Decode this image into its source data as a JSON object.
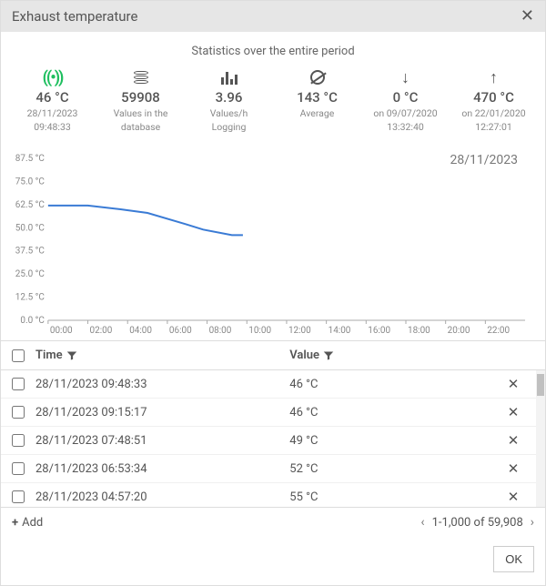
{
  "title": "Exhaust temperature",
  "subtitle": "Statistics over the entire period",
  "stats": {
    "live": {
      "value": "46 °C",
      "sub1": "28/11/2023",
      "sub2": "09:48:33"
    },
    "db": {
      "value": "59908",
      "sub1": "Values in the",
      "sub2": "database"
    },
    "rate": {
      "value": "3.96",
      "sub1": "Values/h",
      "sub2": "Logging"
    },
    "avg": {
      "value": "143 °C",
      "sub1": "Average",
      "sub2": ""
    },
    "min": {
      "value": "0 °C",
      "sub1": "on 09/07/2020",
      "sub2": "13:32:40"
    },
    "max": {
      "value": "470 °C",
      "sub1": "on 22/01/2020",
      "sub2": "12:27:01"
    }
  },
  "chart_data": {
    "type": "line",
    "title": "",
    "date_label": "28/11/2023",
    "xlabel": "",
    "ylabel": "",
    "ylim": [
      0,
      87.5
    ],
    "y_ticks": [
      "87.5 °C",
      "75.0 °C",
      "62.5 °C",
      "50.0 °C",
      "37.5 °C",
      "25.0 °C",
      "12.5 °C",
      "0.0 °C"
    ],
    "x_ticks": [
      "00:00",
      "02:00",
      "04:00",
      "06:00",
      "08:00",
      "10:00",
      "12:00",
      "14:00",
      "16:00",
      "18:00",
      "20:00",
      "22:00"
    ],
    "series": [
      {
        "name": "Exhaust temperature",
        "x_hours": [
          0.0,
          1.0,
          2.0,
          3.6,
          5.0,
          6.9,
          7.8,
          9.25,
          9.8
        ],
        "values": [
          62,
          62,
          62,
          60,
          58,
          52,
          49,
          46,
          46
        ]
      }
    ]
  },
  "table": {
    "headers": {
      "time": "Time",
      "value": "Value"
    },
    "rows": [
      {
        "time": "28/11/2023 09:48:33",
        "value": "46 °C"
      },
      {
        "time": "28/11/2023 09:15:17",
        "value": "46 °C"
      },
      {
        "time": "28/11/2023 07:48:51",
        "value": "49 °C"
      },
      {
        "time": "28/11/2023 06:53:34",
        "value": "52 °C"
      },
      {
        "time": "28/11/2023 04:57:20",
        "value": "55 °C"
      }
    ]
  },
  "footer": {
    "add_label": "Add",
    "pager": "1-1,000 of 59,908"
  },
  "buttons": {
    "ok": "OK"
  }
}
